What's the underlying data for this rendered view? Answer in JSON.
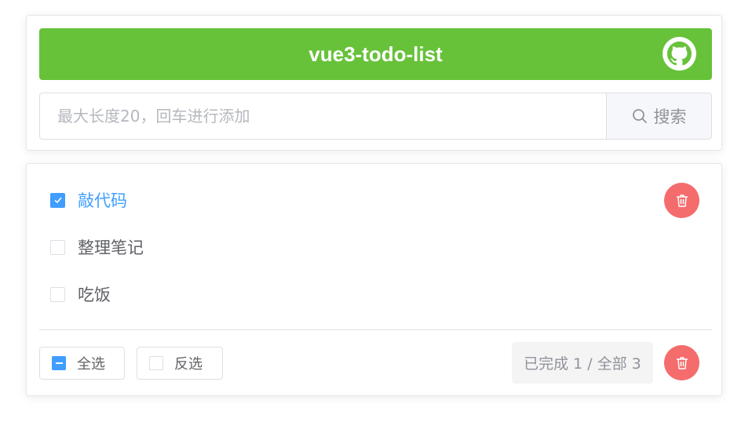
{
  "header": {
    "title": "vue3-todo-list",
    "icon": "github-icon"
  },
  "search": {
    "placeholder": "最大长度20，回车进行添加",
    "value": "",
    "button_label": "搜索",
    "icon": "search-icon"
  },
  "todos": [
    {
      "label": "敲代码",
      "completed": true
    },
    {
      "label": "整理笔记",
      "completed": false
    },
    {
      "label": "吃饭",
      "completed": false
    }
  ],
  "footer": {
    "select_all_label": "全选",
    "select_all_state": "indeterminate",
    "invert_label": "反选",
    "status_text": "已完成 1 / 全部 3"
  },
  "colors": {
    "header_bg": "#67c23a",
    "primary": "#409eff",
    "danger": "#f56c6c"
  }
}
